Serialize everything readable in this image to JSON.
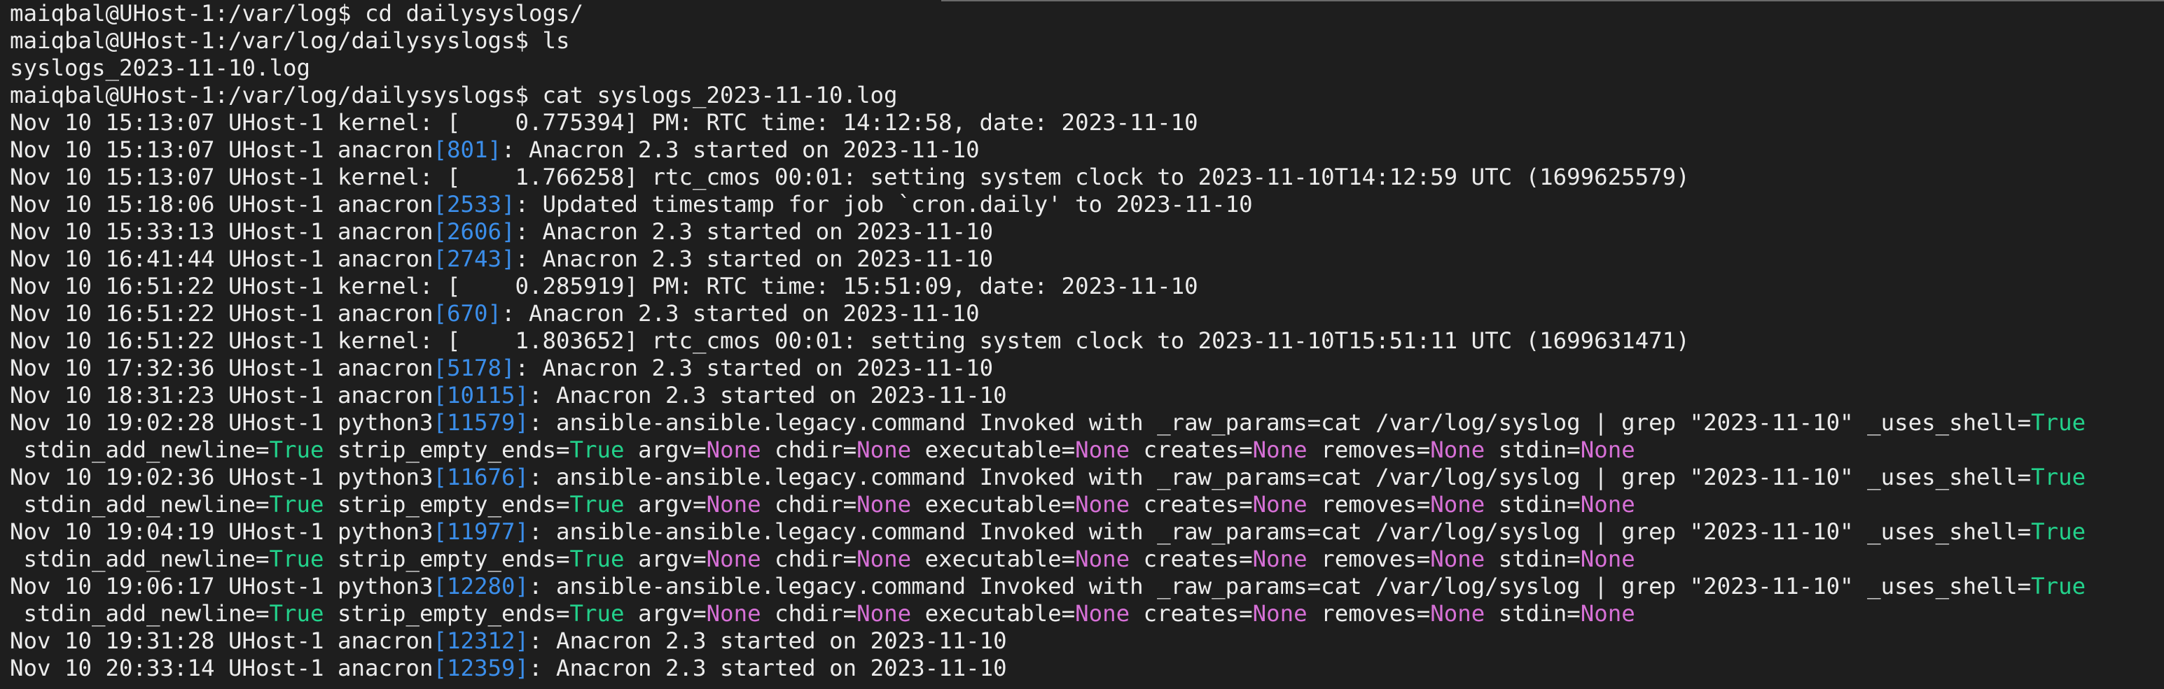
{
  "terminal": {
    "colors": {
      "background": "#1e1e1e",
      "text": "#ececec",
      "pid": "#3b8eea",
      "true_value": "#23d18b",
      "none_value": "#d670d6"
    },
    "lines": [
      [
        {
          "text": "maiqbal@UHost-1:/var/log$ cd dailysyslogs/"
        }
      ],
      [
        {
          "text": "maiqbal@UHost-1:/var/log/dailysyslogs$ ls"
        }
      ],
      [
        {
          "text": "syslogs_2023-11-10.log"
        }
      ],
      [
        {
          "text": "maiqbal@UHost-1:/var/log/dailysyslogs$ cat syslogs_2023-11-10.log"
        }
      ],
      [
        {
          "text": "Nov 10 15:13:07 UHost-1 kernel: [    0.775394] PM: RTC time: 14:12:58, date: 2023-11-10"
        }
      ],
      [
        {
          "text": "Nov 10 15:13:07 UHost-1 anacron"
        },
        {
          "text": "[801]",
          "style": "pid"
        },
        {
          "text": ": Anacron 2.3 started on 2023-11-10"
        }
      ],
      [
        {
          "text": "Nov 10 15:13:07 UHost-1 kernel: [    1.766258] rtc_cmos 00:01: setting system clock to 2023-11-10T14:12:59 UTC (1699625579)"
        }
      ],
      [
        {
          "text": "Nov 10 15:18:06 UHost-1 anacron"
        },
        {
          "text": "[2533]",
          "style": "pid"
        },
        {
          "text": ": Updated timestamp for job `cron.daily' to 2023-11-10"
        }
      ],
      [
        {
          "text": "Nov 10 15:33:13 UHost-1 anacron"
        },
        {
          "text": "[2606]",
          "style": "pid"
        },
        {
          "text": ": Anacron 2.3 started on 2023-11-10"
        }
      ],
      [
        {
          "text": "Nov 10 16:41:44 UHost-1 anacron"
        },
        {
          "text": "[2743]",
          "style": "pid"
        },
        {
          "text": ": Anacron 2.3 started on 2023-11-10"
        }
      ],
      [
        {
          "text": "Nov 10 16:51:22 UHost-1 kernel: [    0.285919] PM: RTC time: 15:51:09, date: 2023-11-10"
        }
      ],
      [
        {
          "text": "Nov 10 16:51:22 UHost-1 anacron"
        },
        {
          "text": "[670]",
          "style": "pid"
        },
        {
          "text": ": Anacron 2.3 started on 2023-11-10"
        }
      ],
      [
        {
          "text": "Nov 10 16:51:22 UHost-1 kernel: [    1.803652] rtc_cmos 00:01: setting system clock to 2023-11-10T15:51:11 UTC (1699631471)"
        }
      ],
      [
        {
          "text": "Nov 10 17:32:36 UHost-1 anacron"
        },
        {
          "text": "[5178]",
          "style": "pid"
        },
        {
          "text": ": Anacron 2.3 started on 2023-11-10"
        }
      ],
      [
        {
          "text": "Nov 10 18:31:23 UHost-1 anacron"
        },
        {
          "text": "[10115]",
          "style": "pid"
        },
        {
          "text": ": Anacron 2.3 started on 2023-11-10"
        }
      ],
      [
        {
          "text": "Nov 10 19:02:28 UHost-1 python3"
        },
        {
          "text": "[11579]",
          "style": "pid"
        },
        {
          "text": ": ansible-ansible.legacy.command Invoked with _raw_params=cat /var/log/syslog | grep \"2023-11-10\" _uses_shell="
        },
        {
          "text": "True",
          "style": "t"
        }
      ],
      [
        {
          "text": " stdin_add_newline="
        },
        {
          "text": "True",
          "style": "t"
        },
        {
          "text": " strip_empty_ends="
        },
        {
          "text": "True",
          "style": "t"
        },
        {
          "text": " argv="
        },
        {
          "text": "None",
          "style": "n"
        },
        {
          "text": " chdir="
        },
        {
          "text": "None",
          "style": "n"
        },
        {
          "text": " executable="
        },
        {
          "text": "None",
          "style": "n"
        },
        {
          "text": " creates="
        },
        {
          "text": "None",
          "style": "n"
        },
        {
          "text": " removes="
        },
        {
          "text": "None",
          "style": "n"
        },
        {
          "text": " stdin="
        },
        {
          "text": "None",
          "style": "n"
        }
      ],
      [
        {
          "text": "Nov 10 19:02:36 UHost-1 python3"
        },
        {
          "text": "[11676]",
          "style": "pid"
        },
        {
          "text": ": ansible-ansible.legacy.command Invoked with _raw_params=cat /var/log/syslog | grep \"2023-11-10\" _uses_shell="
        },
        {
          "text": "True",
          "style": "t"
        }
      ],
      [
        {
          "text": " stdin_add_newline="
        },
        {
          "text": "True",
          "style": "t"
        },
        {
          "text": " strip_empty_ends="
        },
        {
          "text": "True",
          "style": "t"
        },
        {
          "text": " argv="
        },
        {
          "text": "None",
          "style": "n"
        },
        {
          "text": " chdir="
        },
        {
          "text": "None",
          "style": "n"
        },
        {
          "text": " executable="
        },
        {
          "text": "None",
          "style": "n"
        },
        {
          "text": " creates="
        },
        {
          "text": "None",
          "style": "n"
        },
        {
          "text": " removes="
        },
        {
          "text": "None",
          "style": "n"
        },
        {
          "text": " stdin="
        },
        {
          "text": "None",
          "style": "n"
        }
      ],
      [
        {
          "text": "Nov 10 19:04:19 UHost-1 python3"
        },
        {
          "text": "[11977]",
          "style": "pid"
        },
        {
          "text": ": ansible-ansible.legacy.command Invoked with _raw_params=cat /var/log/syslog | grep \"2023-11-10\" _uses_shell="
        },
        {
          "text": "True",
          "style": "t"
        }
      ],
      [
        {
          "text": " stdin_add_newline="
        },
        {
          "text": "True",
          "style": "t"
        },
        {
          "text": " strip_empty_ends="
        },
        {
          "text": "True",
          "style": "t"
        },
        {
          "text": " argv="
        },
        {
          "text": "None",
          "style": "n"
        },
        {
          "text": " chdir="
        },
        {
          "text": "None",
          "style": "n"
        },
        {
          "text": " executable="
        },
        {
          "text": "None",
          "style": "n"
        },
        {
          "text": " creates="
        },
        {
          "text": "None",
          "style": "n"
        },
        {
          "text": " removes="
        },
        {
          "text": "None",
          "style": "n"
        },
        {
          "text": " stdin="
        },
        {
          "text": "None",
          "style": "n"
        }
      ],
      [
        {
          "text": "Nov 10 19:06:17 UHost-1 python3"
        },
        {
          "text": "[12280]",
          "style": "pid"
        },
        {
          "text": ": ansible-ansible.legacy.command Invoked with _raw_params=cat /var/log/syslog | grep \"2023-11-10\" _uses_shell="
        },
        {
          "text": "True",
          "style": "t"
        }
      ],
      [
        {
          "text": " stdin_add_newline="
        },
        {
          "text": "True",
          "style": "t"
        },
        {
          "text": " strip_empty_ends="
        },
        {
          "text": "True",
          "style": "t"
        },
        {
          "text": " argv="
        },
        {
          "text": "None",
          "style": "n"
        },
        {
          "text": " chdir="
        },
        {
          "text": "None",
          "style": "n"
        },
        {
          "text": " executable="
        },
        {
          "text": "None",
          "style": "n"
        },
        {
          "text": " creates="
        },
        {
          "text": "None",
          "style": "n"
        },
        {
          "text": " removes="
        },
        {
          "text": "None",
          "style": "n"
        },
        {
          "text": " stdin="
        },
        {
          "text": "None",
          "style": "n"
        }
      ],
      [
        {
          "text": "Nov 10 19:31:28 UHost-1 anacron"
        },
        {
          "text": "[12312]",
          "style": "pid"
        },
        {
          "text": ": Anacron 2.3 started on 2023-11-10"
        }
      ],
      [
        {
          "text": "Nov 10 20:33:14 UHost-1 anacron"
        },
        {
          "text": "[12359]",
          "style": "pid"
        },
        {
          "text": ": Anacron 2.3 started on 2023-11-10"
        }
      ]
    ]
  }
}
